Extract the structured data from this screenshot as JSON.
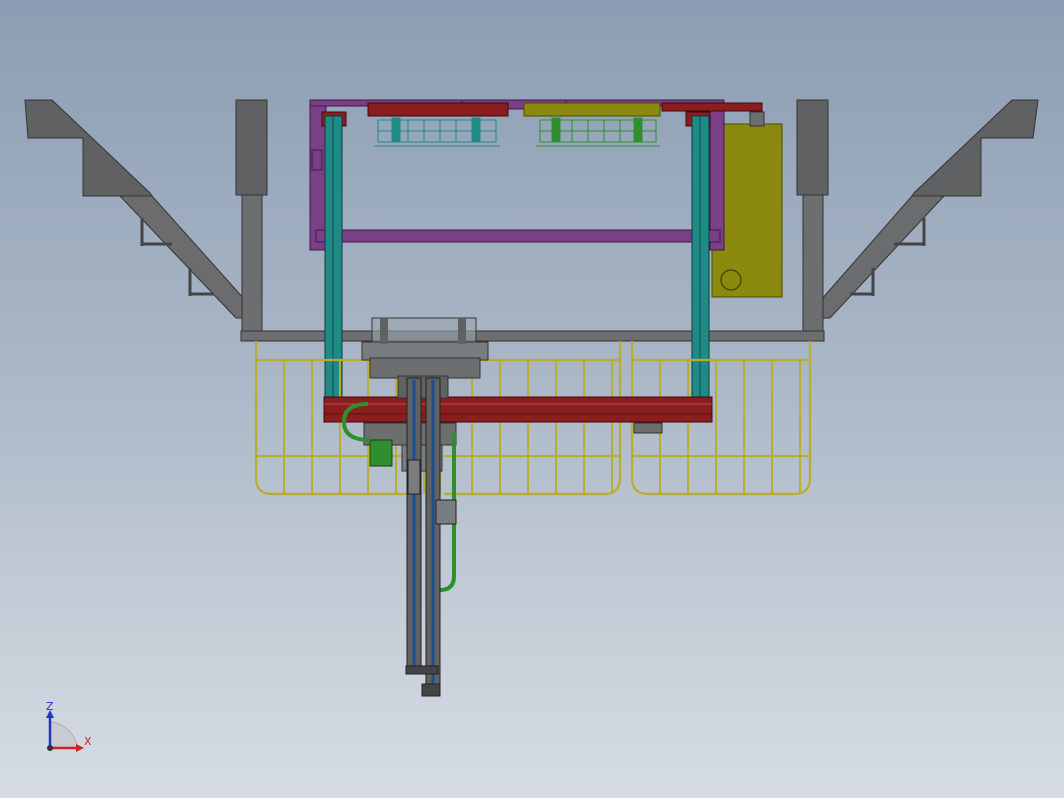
{
  "colors": {
    "background_top": "#8c9db3",
    "background_bottom": "#d6dce4",
    "steel_gray": "#5f6163",
    "frame_purple": "#7b3f87",
    "column_teal": "#1f8a86",
    "beam_red": "#8a1e1e",
    "railing_yellow": "#b8ad2f",
    "panel_olive": "#8c8a0e",
    "rod_blue": "#1d4f8f",
    "hose_green": "#2f8f2f",
    "axis_z": "#2233cc",
    "axis_x": "#cc2222"
  },
  "triad": {
    "z_label": "Z",
    "x_label": "X"
  }
}
